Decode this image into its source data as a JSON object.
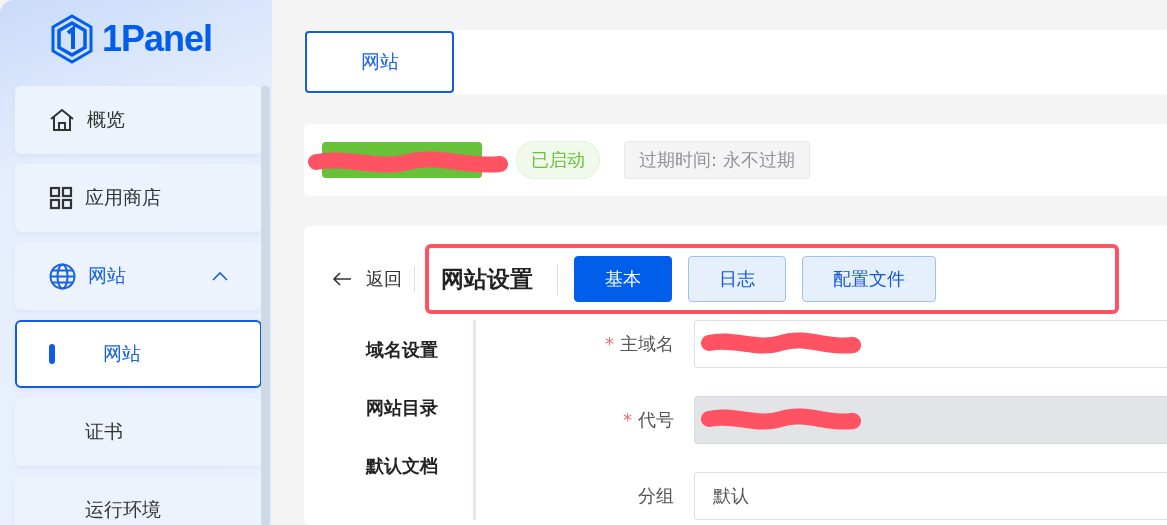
{
  "logo": {
    "text": "1Panel"
  },
  "sidebar": {
    "items": [
      {
        "label": "概览",
        "kind": "home",
        "selected": false
      },
      {
        "label": "应用商店",
        "kind": "apps",
        "selected": false
      },
      {
        "label": "网站",
        "kind": "globe",
        "selected": true,
        "expanded": true,
        "children": [
          {
            "label": "网站",
            "selected": true
          },
          {
            "label": "证书",
            "selected": false
          },
          {
            "label": "运行环境",
            "selected": false
          }
        ]
      }
    ]
  },
  "tabs": [
    {
      "label": "网站",
      "selected": true
    }
  ],
  "site": {
    "name_redacted": true,
    "status": "已启动",
    "expiry": "过期时间: 永不过期"
  },
  "settings": {
    "back": "返回",
    "title": "网站设置",
    "highlighted": true,
    "tabs": [
      {
        "label": "基本",
        "selected": true
      },
      {
        "label": "日志",
        "selected": false
      },
      {
        "label": "配置文件",
        "selected": false
      }
    ],
    "nav": [
      "域名设置",
      "网站目录",
      "默认文档"
    ],
    "fields": [
      {
        "label": "主域名",
        "required_mark": "*",
        "disabled": false,
        "redacted": true
      },
      {
        "label": "代号",
        "required_mark": "*",
        "disabled": true,
        "redacted": true
      },
      {
        "label": "分组",
        "disabled": false,
        "redacted": false,
        "value": "默认"
      }
    ]
  }
}
